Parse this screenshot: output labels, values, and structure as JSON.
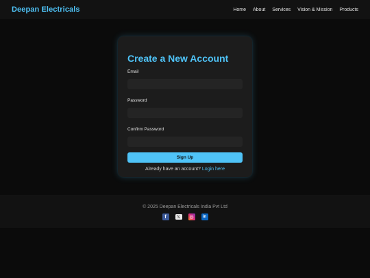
{
  "header": {
    "brand": "Deepan Electricals",
    "nav": [
      {
        "label": "Home"
      },
      {
        "label": "About"
      },
      {
        "label": "Services"
      },
      {
        "label": "Vision & Mission"
      },
      {
        "label": "Products"
      }
    ]
  },
  "form": {
    "title": "Create a New Account",
    "email_label": "Email",
    "email_value": "",
    "password_label": "Password",
    "password_value": "",
    "confirm_label": "Confirm Password",
    "confirm_value": "",
    "submit_label": "Sign Up",
    "login_prompt": "Already have an account?",
    "login_link": "Login here"
  },
  "footer": {
    "copyright": "© 2025 Deepan Electricals India Pvt Ltd",
    "socials": [
      {
        "icon": "facebook-icon",
        "glyph": "f"
      },
      {
        "icon": "x-twitter-icon",
        "glyph": "𝕏"
      },
      {
        "icon": "instagram-icon",
        "glyph": "◎"
      },
      {
        "icon": "linkedin-icon",
        "glyph": "in"
      }
    ]
  },
  "colors": {
    "accent": "#4fc3f7",
    "background": "#0b0b0b",
    "card": "#1c1c1c"
  }
}
